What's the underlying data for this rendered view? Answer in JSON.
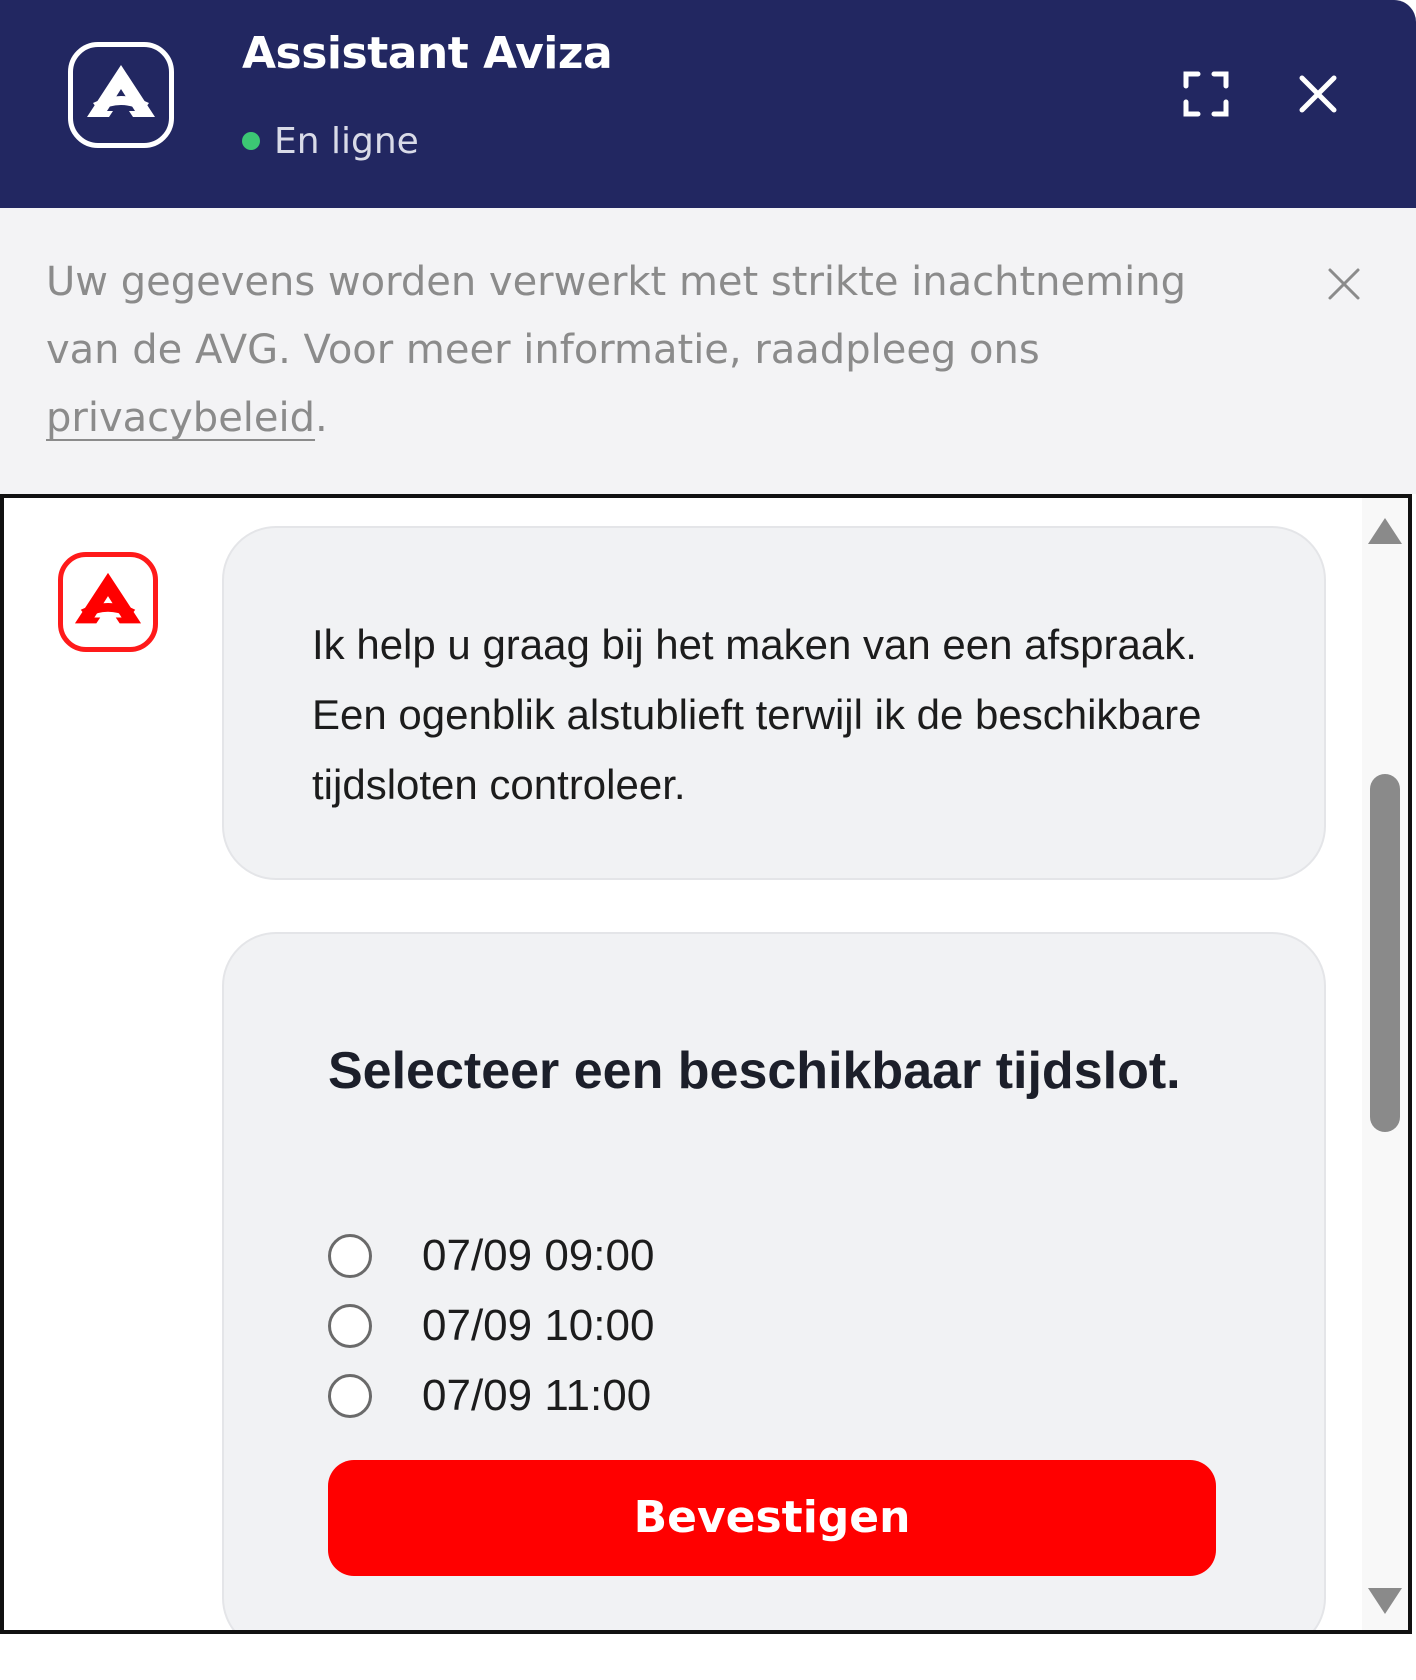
{
  "header": {
    "title": "Assistant Aviza",
    "status": "En ligne",
    "status_color": "#3cc774",
    "background": "#222761",
    "logo_icon": "aviza-logo-icon",
    "expand_icon": "expand-icon",
    "close_icon": "close-icon"
  },
  "notice": {
    "text_before_link": "Uw gegevens worden verwerkt met strikte inachtneming van de AVG. Voor meer informatie, raadpleeg ons ",
    "link_text": "privacybeleid",
    "text_after_link": ".",
    "close_icon": "close-icon"
  },
  "chat": {
    "bot_avatar_icon": "aviza-logo-icon",
    "messages": [
      {
        "text": "Ik help u graag bij het maken van een afspraak. Een ogenblik alstublieft terwijl ik de beschikbare tijdsloten controleer."
      }
    ],
    "slot_form": {
      "title": "Selecteer een beschikbaar tijdslot.",
      "options": [
        {
          "label": "07/09 09:00",
          "selected": false
        },
        {
          "label": "07/09 10:00",
          "selected": false
        },
        {
          "label": "07/09 11:00",
          "selected": false
        }
      ],
      "confirm_label": "Bevestigen",
      "confirm_color": "#ff0000"
    }
  }
}
